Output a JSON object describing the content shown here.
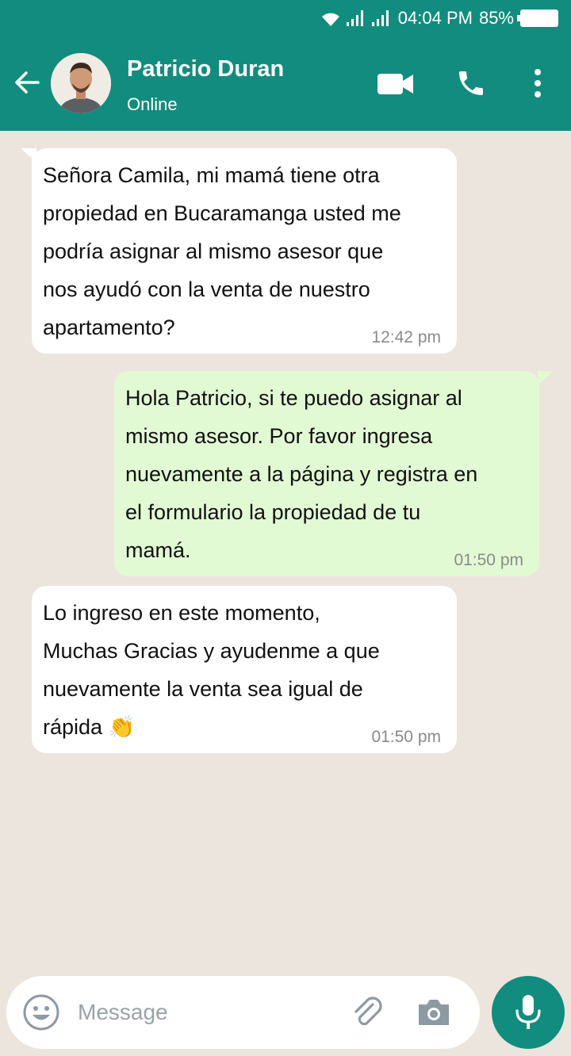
{
  "status_bar": {
    "time": "04:04 PM",
    "battery": "85%",
    "icons": [
      "wifi-icon",
      "signal-icon",
      "signal-icon",
      "battery-icon"
    ]
  },
  "header": {
    "contact_name": "Patricio Duran",
    "contact_status": "Online",
    "icons": [
      "back-arrow-icon",
      "video-call-icon",
      "phone-icon",
      "more-options-icon"
    ],
    "color": "#128c7e"
  },
  "messages": [
    {
      "direction": "incoming",
      "text": " Señora Camila, mi mamá tiene otra\npropiedad en Bucaramanga usted me\npodría asignar al mismo asesor que\nnos ayudó con la venta de nuestro\napartamento?",
      "time": "12:42 pm"
    },
    {
      "direction": "outgoing",
      "text": " Hola Patricio, si te puedo asignar al\nmismo asesor. Por favor ingresa\nnuevamente a la página y registra en\nel formulario la  propiedad de tu\nmamá.",
      "time": "01:50 pm"
    },
    {
      "direction": "incoming",
      "text": " Lo ingreso en este momento,\nMuchas Gracias y ayudenme a que\nnuevamente la venta sea igual de\nrápida 👏",
      "time": "01:50 pm"
    }
  ],
  "composer": {
    "placeholder": "Message",
    "icons": [
      "emoji-icon",
      "attachment-icon",
      "camera-icon",
      "microphone-icon"
    ]
  },
  "colors": {
    "background": "#ece5dd",
    "incoming_bubble": "#ffffff",
    "outgoing_bubble": "#e2fad4",
    "accent": "#128c7e"
  }
}
